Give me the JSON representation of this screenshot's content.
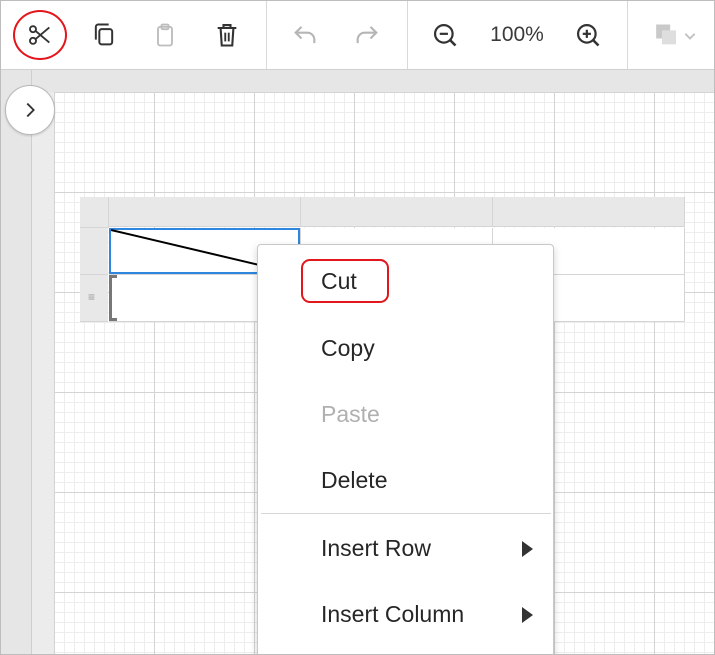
{
  "toolbar": {
    "cut_icon": "scissors-icon",
    "copy_icon": "copy-icon",
    "paste_icon": "clipboard-icon",
    "delete_icon": "trash-icon",
    "undo_icon": "undo-icon",
    "redo_icon": "redo-icon",
    "zoom_out_icon": "zoom-out-icon",
    "zoom_level": "100%",
    "zoom_in_icon": "zoom-in-icon",
    "fill_color_icon": "fill-color-icon"
  },
  "canvas": {
    "expand_icon": "chevron-right-icon"
  },
  "context_menu": {
    "items": [
      {
        "label": "Cut",
        "enabled": true
      },
      {
        "label": "Copy",
        "enabled": true
      },
      {
        "label": "Paste",
        "enabled": false
      },
      {
        "label": "Delete",
        "enabled": true
      },
      {
        "label": "Insert Row",
        "enabled": true,
        "submenu": true
      },
      {
        "label": "Insert Column",
        "enabled": true,
        "submenu": true
      }
    ]
  },
  "colors": {
    "highlight": "#e3161b",
    "selection": "#2e86de",
    "disabled_text": "#b0b0b0"
  }
}
